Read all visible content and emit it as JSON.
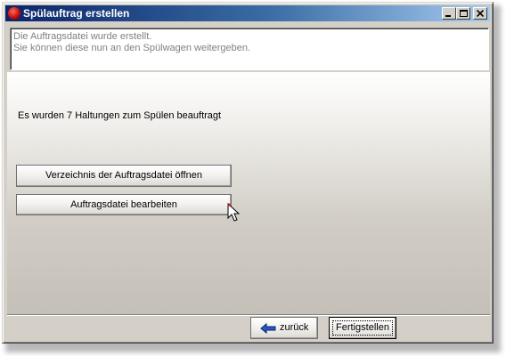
{
  "window": {
    "title": "Spülauftrag erstellen"
  },
  "info": {
    "line1": "Die Auftragsdatei wurde erstellt.",
    "line2": "Sie können diese nun an den Spülwagen weitergeben."
  },
  "main": {
    "status": "Es wurden 7 Haltungen zum Spülen beauftragt",
    "open_folder_label": "Verzeichnis der Auftragsdatei öffnen",
    "edit_file_label": "Auftragsdatei bearbeiten"
  },
  "footer": {
    "back_label": "zurück",
    "finish_label": "Fertigstellen"
  },
  "colors": {
    "titlebar_start": "#0a246a",
    "titlebar_end": "#a6caf0",
    "face": "#d4d0c8",
    "info_text": "#808080"
  },
  "icons": {
    "app": "app-icon",
    "back": "arrow-left-icon",
    "cursor": "mouse-pointer-icon"
  }
}
